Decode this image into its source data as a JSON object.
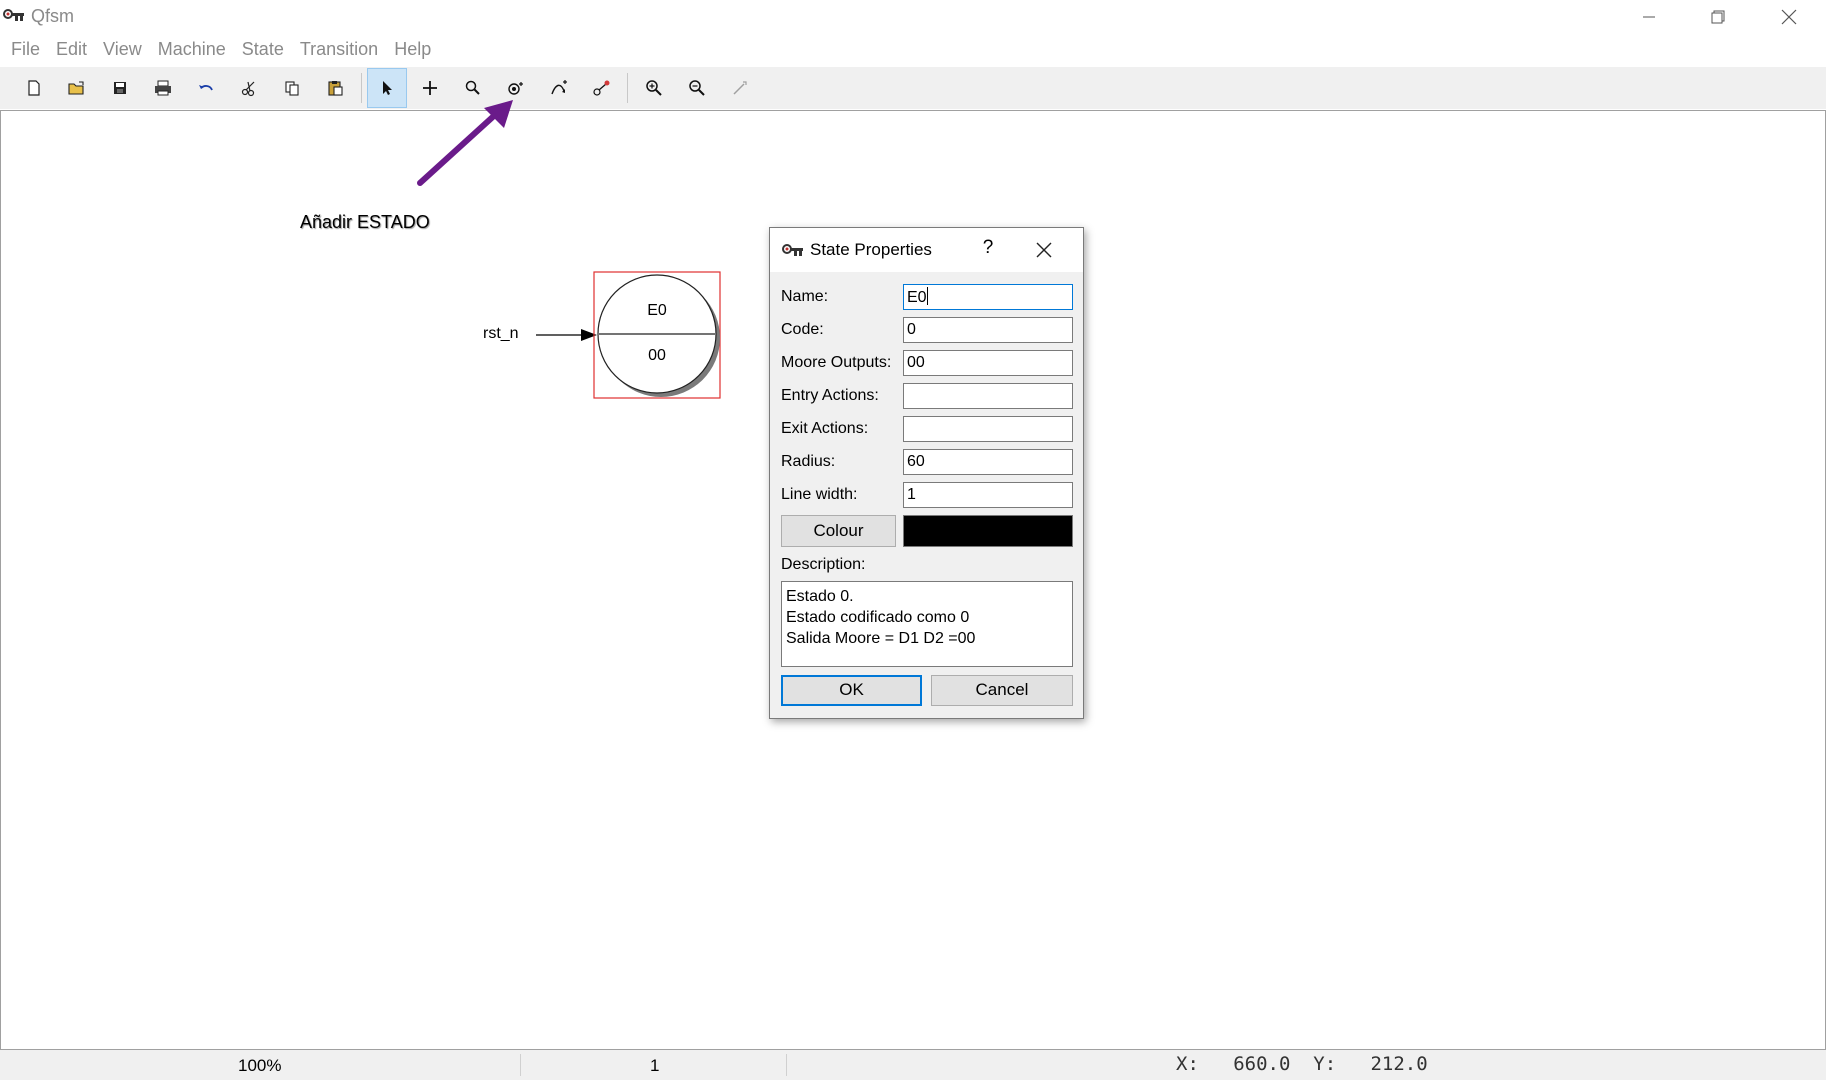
{
  "window": {
    "title": "Qfsm",
    "app_icon": "qfsm-key-icon",
    "controls": [
      "minimize-icon",
      "restore-icon",
      "close-icon"
    ]
  },
  "menu": [
    "File",
    "Edit",
    "View",
    "Machine",
    "State",
    "Transition",
    "Help"
  ],
  "toolbar": {
    "buttons": [
      {
        "name": "new-file-icon"
      },
      {
        "name": "open-folder-icon"
      },
      {
        "name": "save-icon"
      },
      {
        "name": "print-icon"
      },
      {
        "name": "undo-icon"
      },
      {
        "name": "cut-icon"
      },
      {
        "name": "copy-icon"
      },
      {
        "name": "paste-icon"
      },
      {
        "name": "select-pointer-icon",
        "active": true
      },
      {
        "name": "pan-cross-icon"
      },
      {
        "name": "zoom-tool-icon"
      },
      {
        "name": "add-state-icon"
      },
      {
        "name": "add-transition-icon"
      },
      {
        "name": "straighten-transition-icon"
      },
      {
        "name": "zoom-in-icon"
      },
      {
        "name": "zoom-out-icon"
      },
      {
        "name": "simulate-wand-icon",
        "disabled": true
      }
    ]
  },
  "canvas": {
    "annotation": {
      "text": "Añadir ESTADO",
      "arrow_color": "#6a1b8a"
    },
    "state": {
      "name": "E0",
      "output": "00",
      "selection_color": "#e03030"
    },
    "reset_transition": {
      "label": "rst_n"
    }
  },
  "dialog": {
    "title": "State Properties",
    "help_label": "?",
    "fields": [
      {
        "label": "Name:",
        "value": "E0",
        "focused": true
      },
      {
        "label": "Code:",
        "value": "0"
      },
      {
        "label": "Moore Outputs:",
        "value": "00"
      },
      {
        "label": "Entry Actions:",
        "value": ""
      },
      {
        "label": "Exit Actions:",
        "value": ""
      },
      {
        "label": "Radius:",
        "value": "60"
      },
      {
        "label": "Line width:",
        "value": "1"
      }
    ],
    "colour_button": "Colour",
    "colour_value": "#000000",
    "description_label": "Description:",
    "description_lines": [
      "Estado 0.",
      "Estado codificado como 0",
      "Salida Moore = D1 D2 =00"
    ],
    "ok_label": "OK",
    "cancel_label": "Cancel"
  },
  "status": {
    "zoom": "100%",
    "page": "1",
    "coords": "X:   660.0  Y:   212.0"
  }
}
